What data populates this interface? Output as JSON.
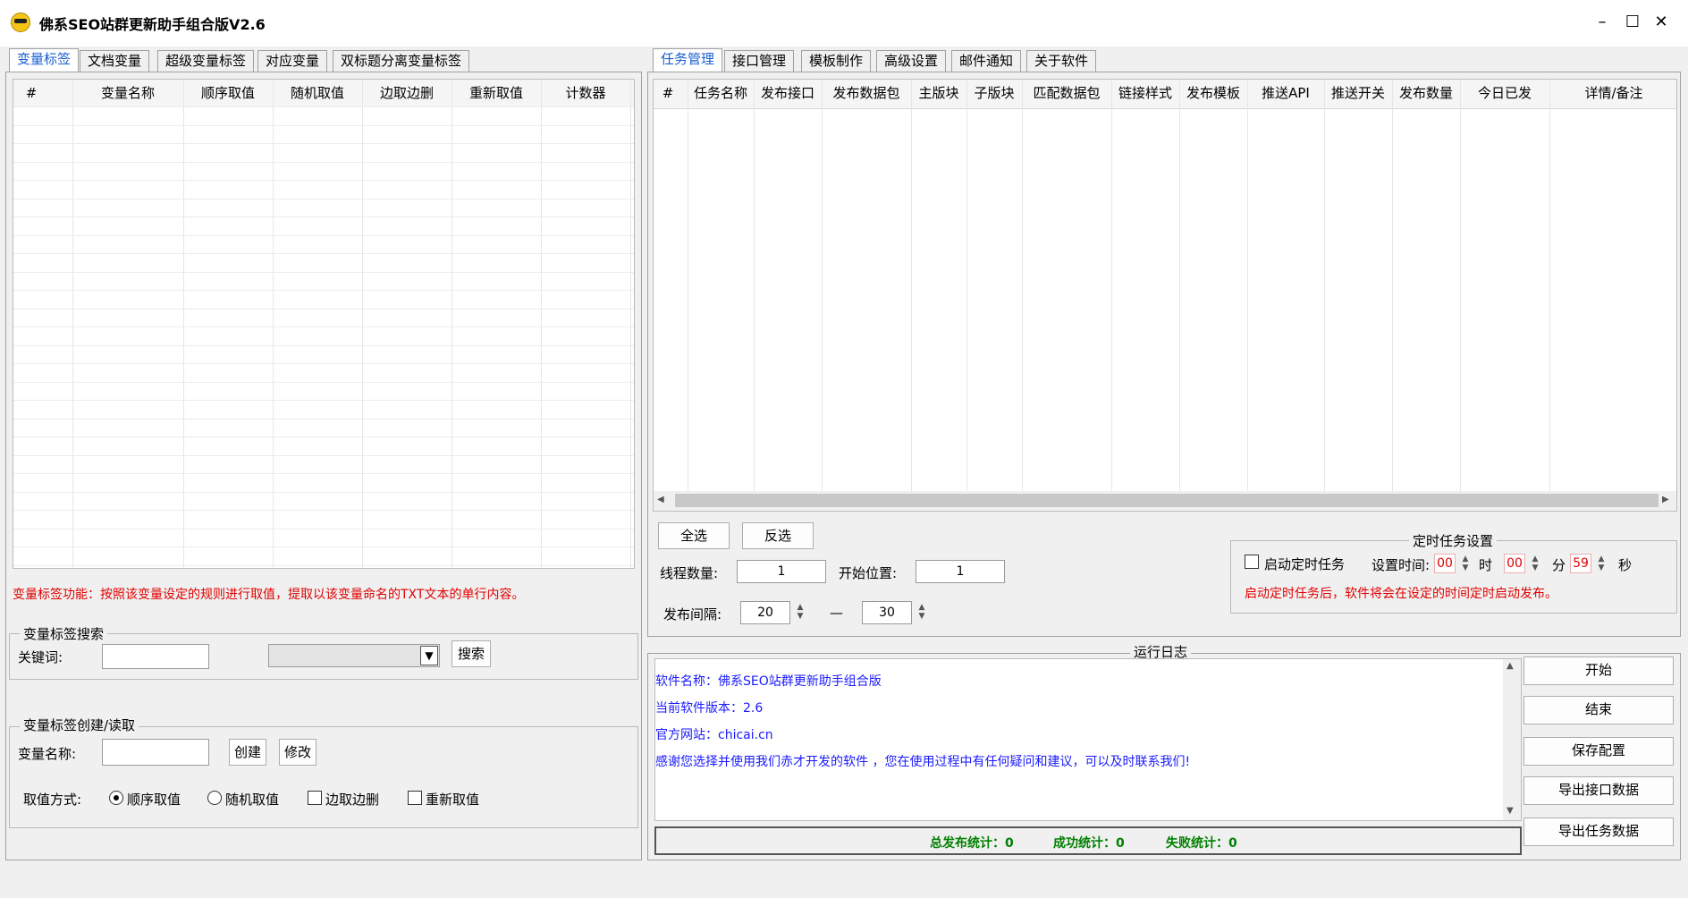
{
  "window": {
    "title": "佛系SEO站群更新助手组合版V2.6",
    "minimize": "–",
    "maximize": "☐",
    "close": "✕"
  },
  "left_tabs": [
    "变量标签",
    "文档变量",
    "超级变量标签",
    "对应变量",
    "双标题分离变量标签"
  ],
  "right_tabs": [
    "任务管理",
    "接口管理",
    "模板制作",
    "高级设置",
    "邮件通知",
    "关于软件"
  ],
  "var_table": {
    "columns": [
      "#",
      "变量名称",
      "顺序取值",
      "随机取值",
      "边取边删",
      "重新取值",
      "计数器"
    ]
  },
  "var_description": "变量标签功能：按照该变量设定的规则进行取值，提取以该变量命名的TXT文本的单行内容。",
  "search_group": {
    "title": "变量标签搜索",
    "keyword_label": "关键词:",
    "keyword_value": "",
    "dropdown_value": "",
    "search_button": "搜索"
  },
  "create_group": {
    "title": "变量标签创建/读取",
    "name_label": "变量名称:",
    "name_value": "",
    "create_button": "创建",
    "modify_button": "修改",
    "mode_label": "取值方式:",
    "modes": [
      "顺序取值",
      "随机取值",
      "边取边删",
      "重新取值"
    ],
    "selected_mode": "顺序取值"
  },
  "task_table": {
    "columns": [
      "#",
      "任务名称",
      "发布接口",
      "发布数据包",
      "主版块",
      "子版块",
      "匹配数据包",
      "链接样式",
      "发布模板",
      "推送API",
      "推送开关",
      "发布数量",
      "今日已发",
      "详情/备注"
    ]
  },
  "task_controls": {
    "select_all": "全选",
    "invert": "反选",
    "threads_label": "线程数量:",
    "threads_value": "1",
    "start_pos_label": "开始位置:",
    "start_pos_value": "1",
    "interval_label": "发布间隔:",
    "interval_min": "20",
    "interval_sep": "—",
    "interval_max": "30"
  },
  "timer": {
    "title": "定时任务设置",
    "enable_label": "启动定时任务",
    "set_time_label": "设置时间:",
    "hour": "00",
    "hour_unit": "时",
    "minute": "00",
    "minute_unit": "分",
    "second": "59",
    "second_unit": "秒",
    "note": "启动定时任务后，软件将会在设定的时间定时启动发布。"
  },
  "log": {
    "title": "运行日志",
    "lines": [
      "软件名称：佛系SEO站群更新助手组合版",
      "当前软件版本：2.6",
      "官方网站：chicai.cn",
      "感谢您选择并使用我们赤才开发的软件 ，您在使用过程中有任何疑问和建议，可以及时联系我们!"
    ]
  },
  "stats": {
    "total": "总发布统计：0",
    "success": "成功统计：0",
    "fail": "失败统计：0"
  },
  "action_buttons": [
    "开始",
    "结束",
    "保存配置",
    "导出接口数据",
    "导出任务数据"
  ],
  "colors": {
    "accent": "#1a5fd0",
    "warning": "#e00000",
    "log_text": "#1a1aff",
    "stats_text": "#008000"
  }
}
